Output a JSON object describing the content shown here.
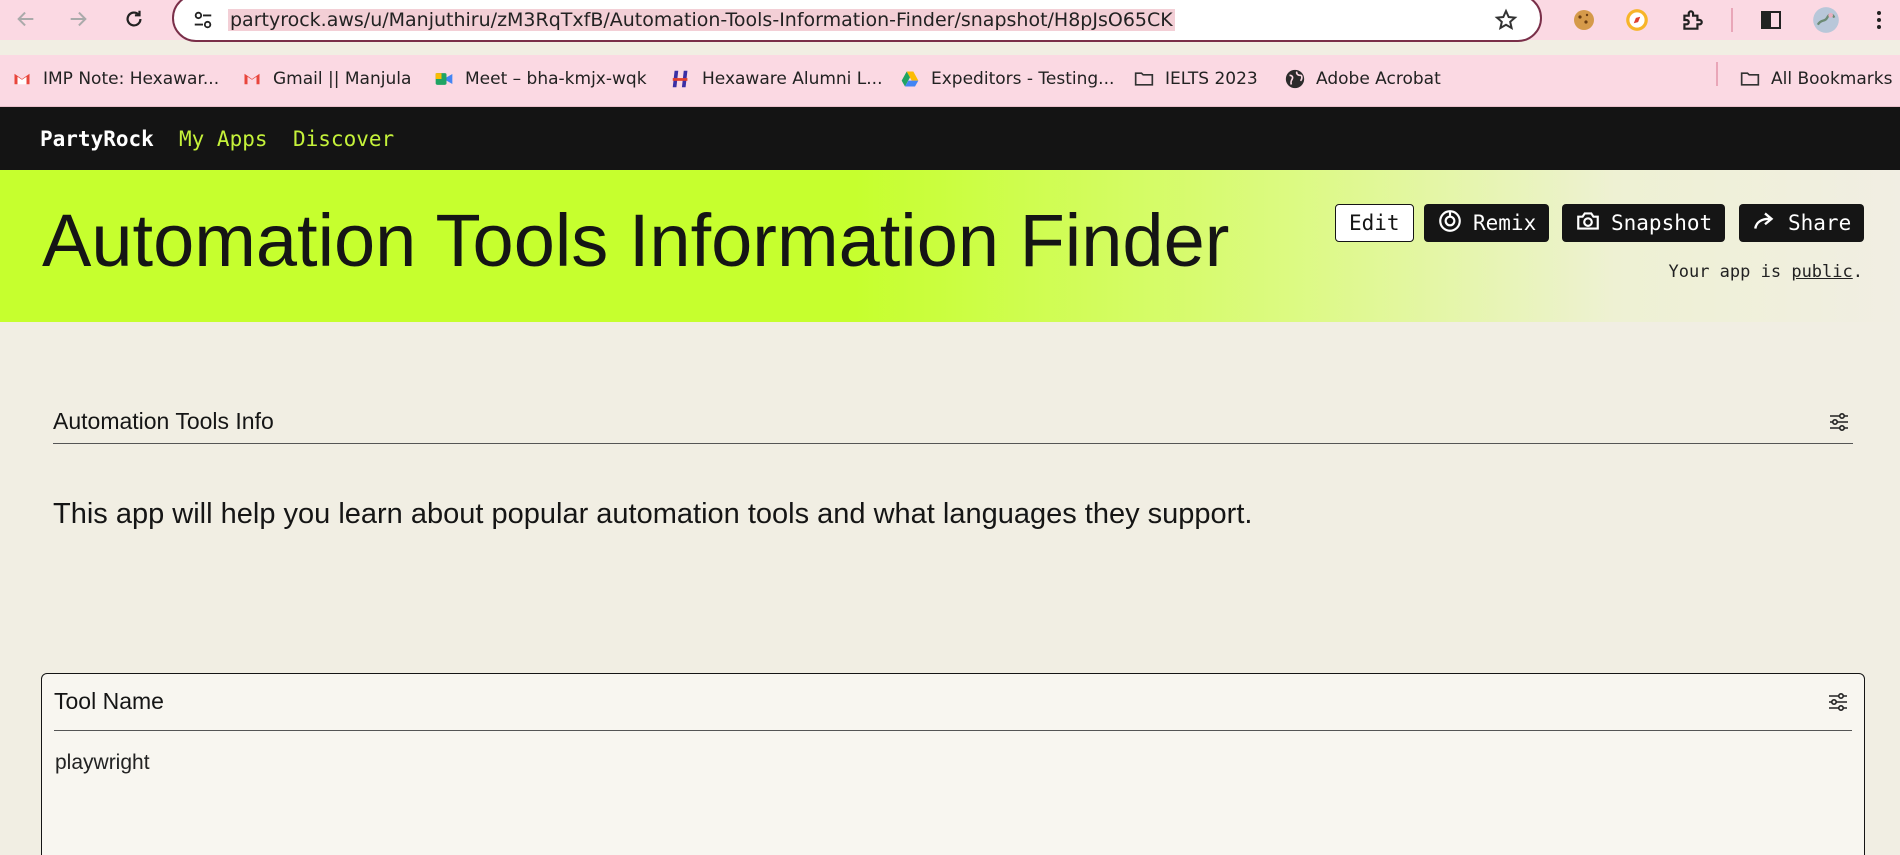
{
  "browser": {
    "url": "partyrock.aws/u/Manjuthiru/zM3RqTxfB/Automation-Tools-Information-Finder/snapshot/H8pJsO65CK",
    "bookmarks": [
      {
        "label": "IMP Note: Hexawar...",
        "icon": "gmail-icon"
      },
      {
        "label": "Gmail || Manjula",
        "icon": "gmail-icon"
      },
      {
        "label": "Meet – bha-kmjx-wqk",
        "icon": "meet-icon"
      },
      {
        "label": "Hexaware Alumni L...",
        "icon": "hexaware-icon"
      },
      {
        "label": "Expeditors - Testing...",
        "icon": "drive-icon"
      },
      {
        "label": "IELTS 2023",
        "icon": "folder-icon"
      },
      {
        "label": "Adobe Acrobat",
        "icon": "globe-icon"
      }
    ],
    "all_bookmarks": "All Bookmarks"
  },
  "app_nav": {
    "brand": "PartyRock",
    "links": [
      "My Apps",
      "Discover"
    ]
  },
  "hero": {
    "title": "Automation Tools Information Finder",
    "buttons": {
      "edit": "Edit",
      "remix": "Remix",
      "snapshot": "Snapshot",
      "share": "Share"
    },
    "visibility_prefix": "Your app is ",
    "visibility_link": "public",
    "visibility_suffix": "."
  },
  "widgets": {
    "info": {
      "title": "Automation Tools Info",
      "text": "This app will help you learn about popular automation tools and what languages they support."
    },
    "tool_name": {
      "title": "Tool Name",
      "value": "playwright"
    }
  },
  "colors": {
    "accent_lime": "#c6ff2e",
    "nav_bg": "#141414",
    "nav_link": "#c5f23a",
    "browser_chrome": "#fbd9e3"
  }
}
